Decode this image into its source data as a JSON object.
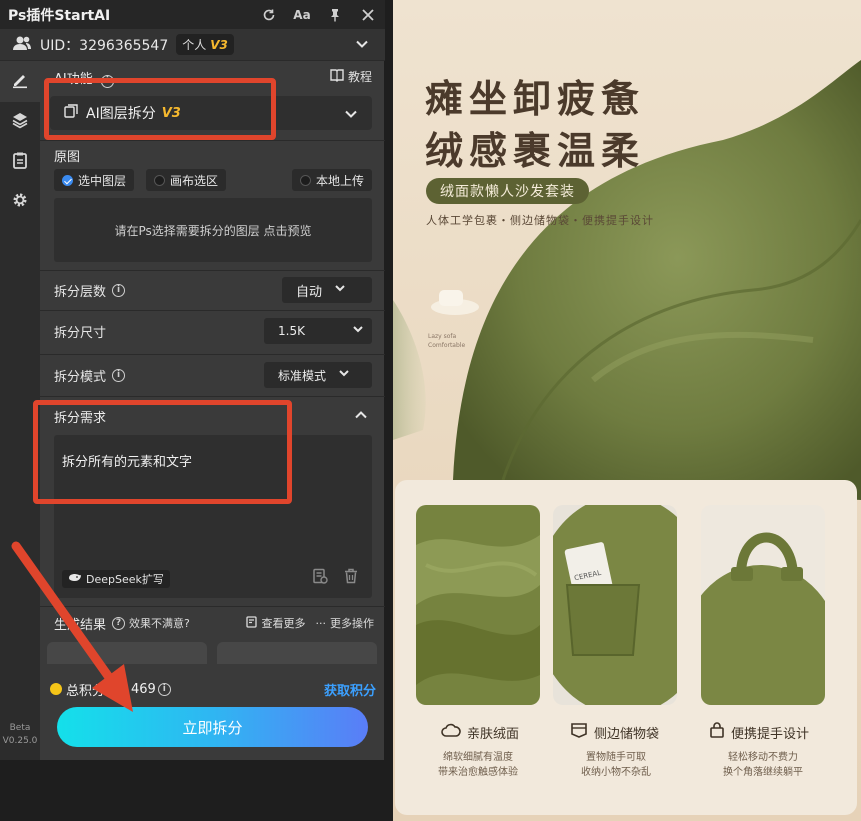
{
  "window": {
    "title": "Ps插件StartAI",
    "icons": [
      "refresh-icon",
      "font-size-icon",
      "pin-icon",
      "close-icon"
    ],
    "font_icon_text": "Aa"
  },
  "user": {
    "uid": "UID：3296365547",
    "plan": "个人",
    "version_badge": "V3"
  },
  "sidebar": {
    "items": [
      "edit-icon",
      "layers-icon",
      "clipboard-icon",
      "gear-icon"
    ],
    "beta_label": "Beta",
    "version": "V0.25.0"
  },
  "ai_function": {
    "label": "AI功能",
    "tutorial": "教程",
    "selected": "AI图层拆分",
    "selected_badge": "V3"
  },
  "source": {
    "label": "原图",
    "options": [
      "选中图层",
      "画布选区",
      "本地上传"
    ],
    "selected_index": 0,
    "hint": "请在Ps选择需要拆分的图层 点击预览"
  },
  "params": {
    "layers_label": "拆分层数",
    "layers_value": "自动",
    "size_label": "拆分尺寸",
    "size_value": "1.5K",
    "mode_label": "拆分模式",
    "mode_value": "标准模式"
  },
  "requirement": {
    "label": "拆分需求",
    "text": "拆分所有的元素和文字",
    "deepseek": "DeepSeek扩写"
  },
  "result": {
    "label": "生成结果",
    "unsatisfied": "效果不满意?",
    "view_more": "查看更多",
    "more_actions": "更多操作"
  },
  "points": {
    "label": "总积分",
    "value": "469",
    "get": "获取积分"
  },
  "action": {
    "split": "立即拆分"
  },
  "colors": {
    "accent_gold": "#f5b82e",
    "link_blue": "#3ba0ff",
    "annotation_red": "#e0452c",
    "sofa_green": "#7d8a4a"
  },
  "product": {
    "headline_1": "瘫坐卸疲惫",
    "headline_2": "绒感裹温柔",
    "pill": "绒面款懒人沙发套装",
    "subline": "人体工学包裹・侧边储物袋・便携提手设计",
    "cup_text_1": "Lazy sofa",
    "cup_text_2": "Comfortable",
    "pocket_book": "CEREAL",
    "features": [
      {
        "icon": "cloud-icon",
        "title": "亲肤绒面",
        "desc1": "绵软细腻有温度",
        "desc2": "带来治愈触感体验"
      },
      {
        "icon": "pocket-icon",
        "title": "侧边储物袋",
        "desc1": "置物随手可取",
        "desc2": "收纳小物不杂乱"
      },
      {
        "icon": "bag-icon",
        "title": "便携提手设计",
        "desc1": "轻松移动不费力",
        "desc2": "换个角落继续躺平"
      }
    ]
  }
}
